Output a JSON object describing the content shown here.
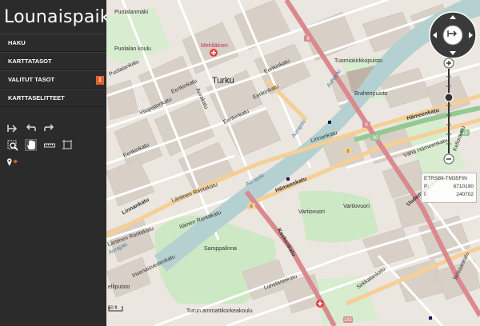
{
  "app": {
    "title": "Lounaispaikka"
  },
  "menu": [
    {
      "label": "HAKU"
    },
    {
      "label": "KARTTATASOT"
    },
    {
      "label": "VALITUT TASOT",
      "badge": "1"
    },
    {
      "label": "KARTTASELITTEET"
    }
  ],
  "tools": {
    "row1": [
      "back-to-start-icon",
      "undo-icon",
      "redo-icon"
    ],
    "row2": [
      "zoom-box-icon",
      "pan-hand-icon",
      "measure-line-icon",
      "measure-area-icon"
    ],
    "row3": [
      "get-info-icon"
    ]
  },
  "coords": {
    "system": "ETRS89-TM35FIN",
    "p_label": "P:",
    "p_value": "6710190",
    "i_label": "I:",
    "i_value": "240702"
  },
  "scale": {
    "label": "50 ft"
  },
  "map_labels": {
    "puolalanmaki": "Puolalanmäki",
    "puolalankoulu": "Puolalan koulu",
    "puolalankatu": "Puolalankatu",
    "turku": "Turku",
    "mehilainen": "Mehiläinen",
    "eerikinkatu1": "Eerikinkatu",
    "eerikinkatu2": "Eerikinkatu",
    "eerikinkatu3": "Eerikinkatu",
    "eerikinkatu4": "Eerikinkatu",
    "eerikinkatu5": "Eerikinkatu",
    "yliopistonkatu": "Yliopistonkatu",
    "aurakatu": "Aurakatu",
    "aurajoki1": "Aurajoki",
    "aurajoki2": "Aurajoki",
    "aurajoki3": "Aurajoki",
    "aurajoki4": "Aurajoki",
    "tuomiokirkkopuisto": "Tuomiokirkkopuisto",
    "brahenpuisto": "Brahenpuisto",
    "hameenkatu1": "Hämeenkatu",
    "hameenkatu2": "Hämeenkatu",
    "hameenkatu3": "Hämeenkatu",
    "linnankatu": "Linnankatu",
    "linnankatu2": "Linnankatu",
    "lantinen": "Läntinen Rantakatu",
    "lantinen2": "Läntinen Rantakatu",
    "itainen": "Itäinen Rantakatu",
    "uudenmaankatu": "Uudenmaankatu",
    "vartiovuori1": "Vartiovuori",
    "vartiovuori2": "Vartiovuori",
    "samppalinna": "Samppalinna",
    "kaskenkatu": "Kaskenkatu",
    "irisenaisvedenkatu": "Irisenaisvedenkatu",
    "lunstaninkatu": "Lunstaninkatu",
    "sirkkalankatu": "Sirkkalankatu",
    "turunammattikorkeakoulu": "Turun ammattikorkeakoulu",
    "vahahameenkatu": "Vähä Hämeenkatu",
    "kellonkatu": "Kellonkatu",
    "tehtaankatu": "Tehtaankatu",
    "ellipuisto": "ellipuisto",
    "valjos": "Vallos"
  },
  "road_numbers": [
    "9",
    "9",
    "10",
    "8",
    "8",
    "10",
    "110",
    "182"
  ],
  "colors": {
    "sidebar_bg": "#2b2b2b",
    "badge": "#e2622c",
    "major_road": "#d98a8f",
    "secondary_road": "#f5cf95",
    "trunk_road": "#93c993",
    "river": "#b5d0d0",
    "park": "#cde8c4",
    "building": "#d8cfc7"
  }
}
